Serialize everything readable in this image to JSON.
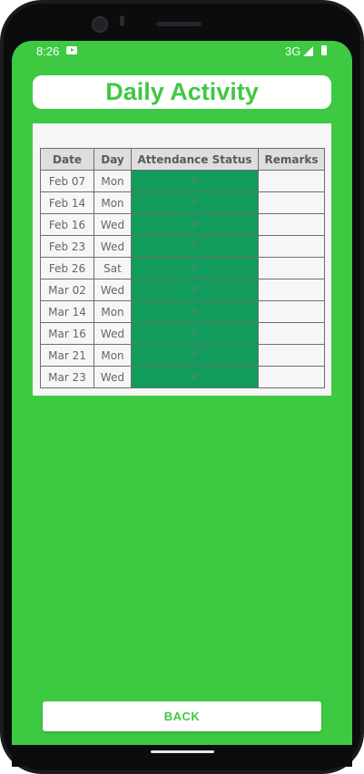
{
  "status_bar": {
    "time": "8:26",
    "network": "3G",
    "icons": [
      "youtube-icon",
      "signal-icon",
      "battery-icon"
    ]
  },
  "header": {
    "title": "Daily Activity"
  },
  "table": {
    "columns": [
      "Date",
      "Day",
      "Attendance Status",
      "Remarks"
    ],
    "rows": [
      {
        "date": "Feb 07",
        "day": "Mon",
        "status": "P",
        "remarks": ""
      },
      {
        "date": "Feb 14",
        "day": "Mon",
        "status": "P",
        "remarks": ""
      },
      {
        "date": "Feb 16",
        "day": "Wed",
        "status": "P",
        "remarks": ""
      },
      {
        "date": "Feb 23",
        "day": "Wed",
        "status": "P",
        "remarks": ""
      },
      {
        "date": "Feb 26",
        "day": "Sat",
        "status": "P",
        "remarks": ""
      },
      {
        "date": "Mar 02",
        "day": "Wed",
        "status": "P",
        "remarks": ""
      },
      {
        "date": "Mar 14",
        "day": "Mon",
        "status": "P",
        "remarks": ""
      },
      {
        "date": "Mar 16",
        "day": "Wed",
        "status": "P",
        "remarks": ""
      },
      {
        "date": "Mar 21",
        "day": "Mon",
        "status": "P",
        "remarks": ""
      },
      {
        "date": "Mar 23",
        "day": "Wed",
        "status": "P",
        "remarks": ""
      }
    ]
  },
  "footer": {
    "back_label": "BACK"
  },
  "colors": {
    "background": "#3ec942",
    "present_status": "#119c5c",
    "accent_text": "#3ec942"
  }
}
